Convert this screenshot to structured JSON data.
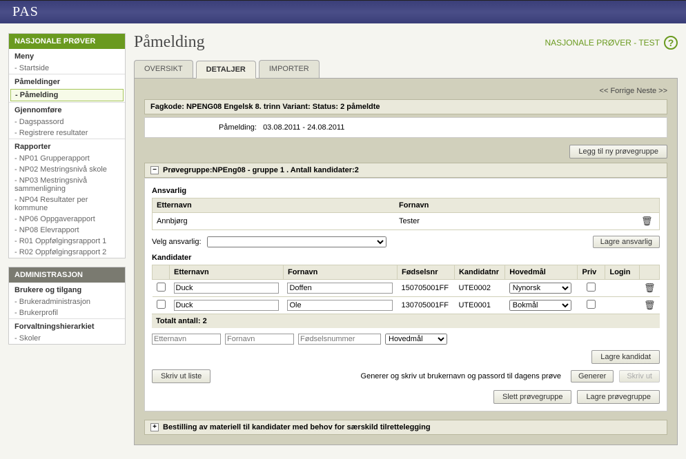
{
  "app": {
    "logo": "PAS"
  },
  "ctx": {
    "label": "NASJONALE PRØVER - TEST"
  },
  "title": "Påmelding",
  "tabs": {
    "overview": "OVERSIKT",
    "details": "DETALJER",
    "import": "IMPORTER"
  },
  "pager": {
    "prev": "<< Forrige",
    "next": "Neste >>"
  },
  "info": {
    "line": "Fagkode: NPENG08 Engelsk 8. trinn Variant: Status: 2 påmeldte"
  },
  "p": {
    "label": "Påmelding:",
    "range": "03.08.2011 - 24.08.2011"
  },
  "btns": {
    "addGroup": "Legg til ny prøvegruppe",
    "saveResp": "Lagre ansvarlig",
    "saveCand": "Lagre kandidat",
    "printList": "Skriv ut liste",
    "generate": "Generer",
    "print": "Skriv ut",
    "deleteGroup": "Slett prøvegruppe",
    "saveGroup": "Lagre prøvegruppe"
  },
  "group": {
    "header": "Prøvegruppe:NPEng08 - gruppe 1 . Antall kandidater:2",
    "respTitle": "Ansvarlig",
    "col_last": "Etternavn",
    "col_first": "Fornavn",
    "resp_last": "Annbjørg",
    "resp_first": "Tester",
    "choose": "Velg ansvarlig:"
  },
  "kand": {
    "title": "Kandidater",
    "h_last": "Etternavn",
    "h_first": "Fornavn",
    "h_fnr": "Fødselsnr",
    "h_knr": "Kandidatnr",
    "h_hm": "Hovedmål",
    "h_priv": "Priv",
    "h_login": "Login",
    "rows": [
      {
        "last": "Duck",
        "first": "Doffen",
        "fnr": "150705001FF",
        "knr": "UTE0002",
        "hm": "Nynorsk"
      },
      {
        "last": "Duck",
        "first": "Ole",
        "fnr": "130705001FF",
        "knr": "UTE0001",
        "hm": "Bokmål"
      }
    ],
    "total": "Totalt antall: 2",
    "ph_last": "Etternavn",
    "ph_first": "Fornavn",
    "ph_fnr": "Fødselsnummer",
    "ph_hm": "Hovedmål"
  },
  "gen_label": "Generer og skriv ut brukernavn og passord til dagens prøve",
  "bestilling": "Bestilling av materiell til kandidater med behov for særskild tilrettelegging",
  "sidebar": {
    "np": "NASJONALE PRØVER",
    "s_meny": "Meny",
    "i_start": "Startside",
    "s_pam": "Påmeldinger",
    "i_pam": "Påmelding",
    "s_gjen": "Gjennomføre",
    "i_dag": "Dagspassord",
    "i_reg": "Registrere resultater",
    "s_rap": "Rapporter",
    "i_r1": "NP01 Grupperapport",
    "i_r2": "NP02 Mestringsnivå skole",
    "i_r3": "NP03 Mestringsnivå sammenligning",
    "i_r4": "NP04 Resultater per kommune",
    "i_r5": "NP06 Oppgaverapport",
    "i_r6": "NP08 Elevrapport",
    "i_r7": "R01 Oppfølgingsrapport 1",
    "i_r8": "R02 Oppfølgingsrapport 2",
    "adm": "ADMINISTRASJON",
    "s_bru": "Brukere og tilgang",
    "i_ba": "Brukeradministrasjon",
    "i_bp": "Brukerprofil",
    "s_forv": "Forvaltningshierarkiet",
    "i_sk": "Skoler"
  }
}
